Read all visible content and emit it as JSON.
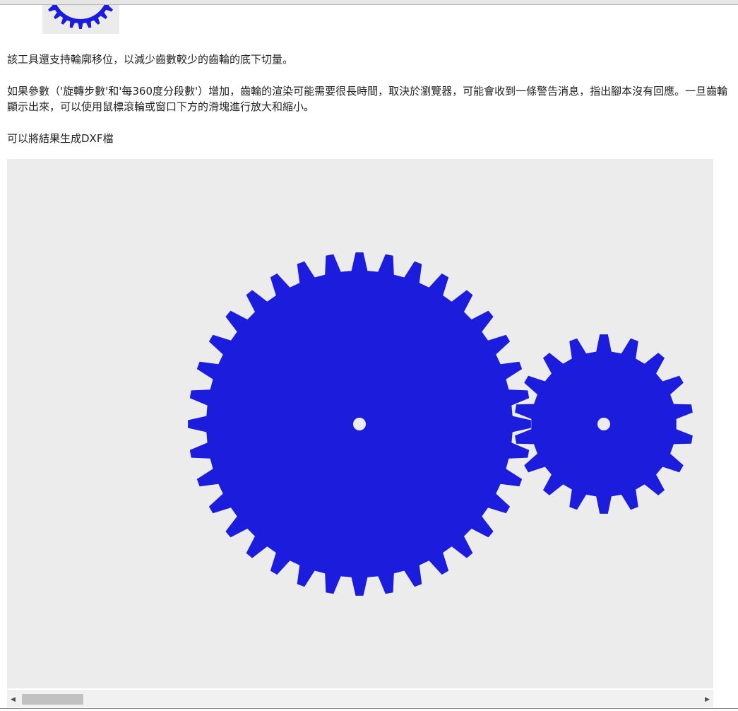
{
  "text": {
    "p1": "該工具還支持輪廓移位，以減少齒數較少的齒輪的底下切量。",
    "p2": "如果參數（'旋轉步數'和'每360度分段數'）增加，齒輪的渲染可能需要很長時間，取決於瀏覽器，可能會收到一條警告消息，指出腳本沒有回應。一旦齒輪顯示出來，可以使用鼠標滾輪或窗口下方的滑塊進行放大和縮小。",
    "p3": "可以將結果生成DXF檔"
  },
  "gears": {
    "color": "#1c1cdd",
    "background": "#ececec",
    "large_gear_teeth": 36,
    "small_gear_teeth": 18
  },
  "scrollbar": {
    "left_arrow": "◀",
    "right_arrow": "▶",
    "position": 0.0
  }
}
